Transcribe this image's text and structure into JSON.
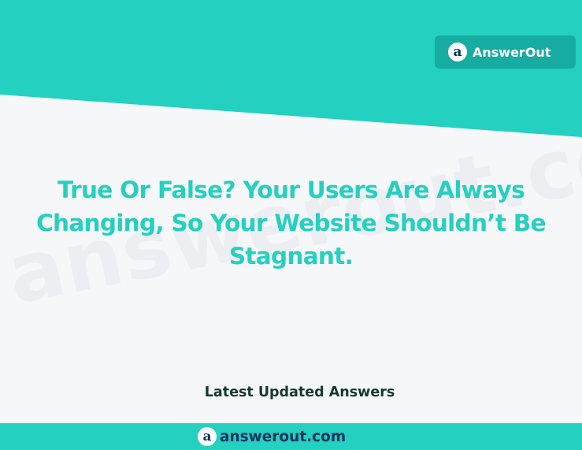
{
  "brand": {
    "logo_letter": "a",
    "name": "AnswerOut"
  },
  "watermark_text": "answerout.com",
  "question": {
    "line1": "True Or False? Your Users Are Always",
    "line2": "Changing, So Your Website Shouldn’t Be",
    "line3": "Stagnant."
  },
  "section_label": "Latest Updated Answers",
  "footer": {
    "logo_letter": "a",
    "site": "answerout.com"
  },
  "colors": {
    "teal": "#24d0c0",
    "badge": "#17aca1",
    "navy": "#0a3360",
    "dark_text": "#163832",
    "background": "#f6f7f9"
  }
}
